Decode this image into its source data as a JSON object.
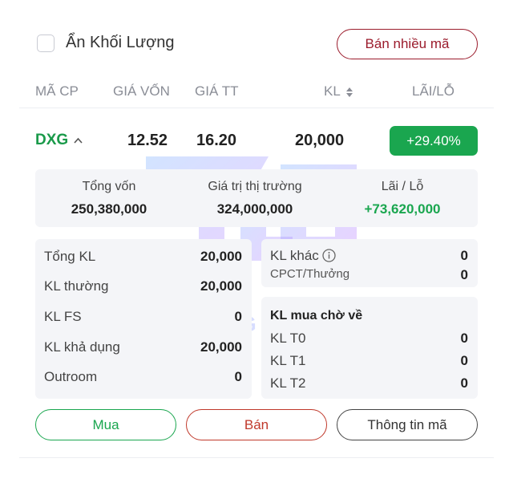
{
  "header": {
    "hide_volume_label": "Ẩn Khối Lượng",
    "hide_volume_checked": false,
    "sell_multi_label": "Bán nhiều mã"
  },
  "columns": {
    "code": "MÃ CP",
    "cost_price": "GIÁ VỐN",
    "market_price": "GIÁ TT",
    "volume": "KL",
    "pnl": "LÃI/LỖ"
  },
  "position": {
    "ticker": "DXG",
    "cost_price": "12.52",
    "market_price": "16.20",
    "volume": "20,000",
    "pnl_percent": "+29.40%"
  },
  "summary": {
    "total_cost_label": "Tổng vốn",
    "total_cost_value": "250,380,000",
    "market_value_label": "Giá trị thị trường",
    "market_value_value": "324,000,000",
    "pnl_label": "Lãi / Lỗ",
    "pnl_value": "+73,620,000"
  },
  "volume_details": {
    "total_label": "Tổng KL",
    "total_value": "20,000",
    "normal_label": "KL thường",
    "normal_value": "20,000",
    "fs_label": "KL FS",
    "fs_value": "0",
    "available_label": "KL khả dụng",
    "available_value": "20,000",
    "outroom_label": "Outroom",
    "outroom_value": "0"
  },
  "other_volume": {
    "other_label": "KL khác",
    "other_value": "0",
    "rights_label": "CPCT/Thưởng",
    "rights_value": "0"
  },
  "pending_buy": {
    "title": "KL mua chờ về",
    "t0_label": "KL T0",
    "t0_value": "0",
    "t1_label": "KL T1",
    "t1_value": "0",
    "t2_label": "KL T2",
    "t2_value": "0"
  },
  "actions": {
    "buy_label": "Mua",
    "sell_label": "Bán",
    "info_label": "Thông tin mã"
  },
  "watermark": {
    "text": "TU LE GENUINE"
  },
  "colors": {
    "green": "#1aa64f",
    "brand_red": "#9b1c2c"
  }
}
